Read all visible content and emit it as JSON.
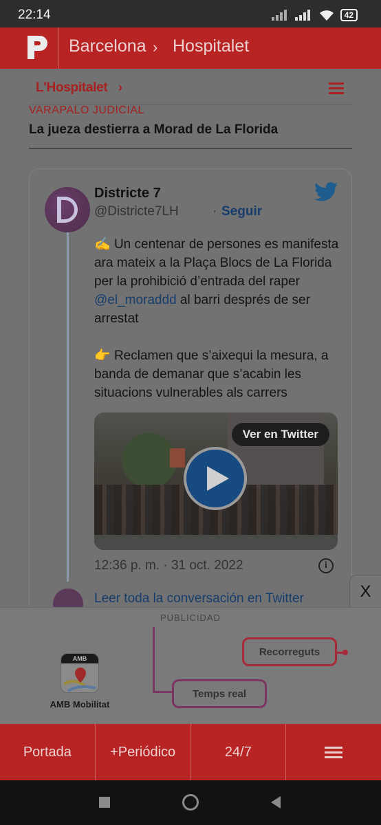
{
  "status_bar": {
    "time": "22:14",
    "battery": "42"
  },
  "top_nav": {
    "crumbs": [
      "Barcelona",
      "Hospitalet"
    ],
    "separator": "›"
  },
  "section": {
    "title": "L'Hospitalet",
    "chevron": "›"
  },
  "article": {
    "kicker": "VARAPALO JUDICIAL",
    "headline": "La jueza destierra a Morad de La Florida"
  },
  "tweet": {
    "author": "Districte 7",
    "handle": "@Districte7LH",
    "separator": "·",
    "follow_label": "Seguir",
    "p1_emoji": "✍️",
    "p1_a": " Un centenar de persones es manifesta ara mateix a la Plaça Blocs de La Florida per la prohibició d’entrada del raper ",
    "p1_mention": "@el_moraddd",
    "p1_b": " al barri després de ser arrestat",
    "p2_emoji": "👉",
    "p2": " Reclamen que s’aixequi la mesura, a banda de demanar que s’acabin les situacions vulnerables als carrers",
    "view_label": "Ver en Twitter",
    "timestamp": "12:36 p. m. · 31 oct. 2022",
    "info_glyph": "i",
    "read_more": "Leer toda la conversación en Twitter"
  },
  "close_label": "X",
  "ad": {
    "label": "PUBLICIDAD",
    "app_badge": "AMB",
    "app_name": "AMB Mobilitat",
    "pill_routes": "Recorreguts",
    "pill_realtime": "Temps real"
  },
  "bottom_nav": {
    "items": [
      "Portada",
      "+Periódico",
      "24/7"
    ]
  },
  "icons": {
    "logo": "periodico-logo-icon",
    "menu": "hamburger-menu-icon",
    "twitter": "twitter-bird-icon",
    "play": "play-icon",
    "info": "info-icon",
    "close": "close-icon"
  },
  "colors": {
    "brand_red": "#b82424",
    "link_blue": "#163d6c",
    "ad_red": "#a82a3a",
    "ad_purple": "#7a3560"
  }
}
